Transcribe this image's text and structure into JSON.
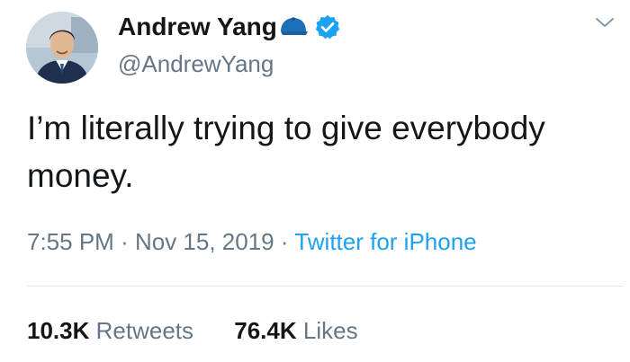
{
  "author": {
    "name": "Andrew Yang",
    "handle": "@AndrewYang",
    "badges": [
      "cap-icon",
      "verified-icon"
    ],
    "verified_color": "#1da1f2"
  },
  "tweet": {
    "text": "I’m literally trying to give everybody money.",
    "time": "7:55 PM",
    "separator": "·",
    "date": "Nov 15, 2019",
    "source": "Twitter for iPhone"
  },
  "stats": {
    "retweets_count": "10.3K",
    "retweets_label": "Retweets",
    "likes_count": "76.4K",
    "likes_label": "Likes"
  },
  "colors": {
    "text": "#14171a",
    "secondary": "#657786",
    "link": "#1da1f2",
    "divider": "#e1e8ed"
  },
  "icons": {
    "menu": "chevron-down-icon"
  }
}
